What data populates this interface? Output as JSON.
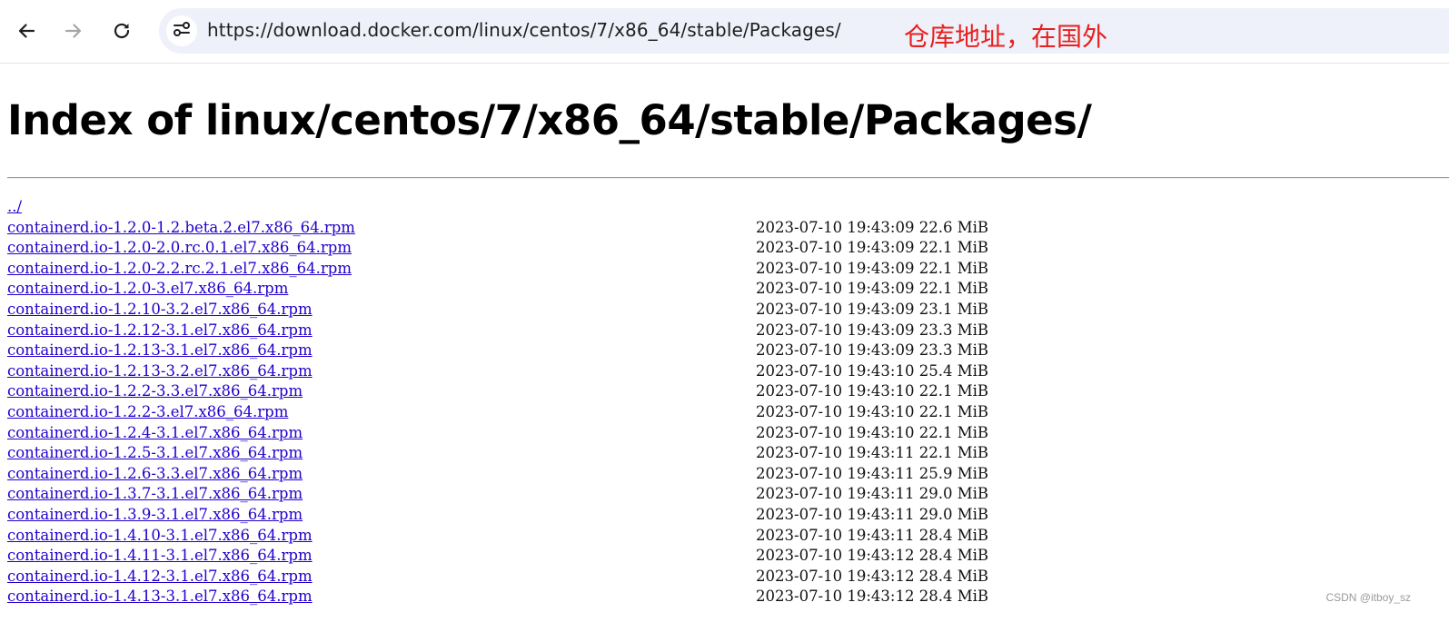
{
  "browser": {
    "back_icon": "arrow-left-icon",
    "forward_icon": "arrow-right-icon",
    "reload_icon": "reload-icon",
    "site_info_icon": "tune-icon",
    "url": "https://download.docker.com/linux/centos/7/x86_64/stable/Packages/"
  },
  "annotation": "仓库地址，在国外",
  "page": {
    "title": "Index of linux/centos/7/x86_64/stable/Packages/",
    "parent_link": "../",
    "files": [
      {
        "name": "containerd.io-1.2.0-1.2.beta.2.el7.x86_64.rpm",
        "date": "2023-07-10 19:43:09",
        "size": "22.6 MiB"
      },
      {
        "name": "containerd.io-1.2.0-2.0.rc.0.1.el7.x86_64.rpm",
        "date": "2023-07-10 19:43:09",
        "size": "22.1 MiB"
      },
      {
        "name": "containerd.io-1.2.0-2.2.rc.2.1.el7.x86_64.rpm",
        "date": "2023-07-10 19:43:09",
        "size": "22.1 MiB"
      },
      {
        "name": "containerd.io-1.2.0-3.el7.x86_64.rpm",
        "date": "2023-07-10 19:43:09",
        "size": "22.1 MiB"
      },
      {
        "name": "containerd.io-1.2.10-3.2.el7.x86_64.rpm",
        "date": "2023-07-10 19:43:09",
        "size": "23.1 MiB"
      },
      {
        "name": "containerd.io-1.2.12-3.1.el7.x86_64.rpm",
        "date": "2023-07-10 19:43:09",
        "size": "23.3 MiB"
      },
      {
        "name": "containerd.io-1.2.13-3.1.el7.x86_64.rpm",
        "date": "2023-07-10 19:43:09",
        "size": "23.3 MiB"
      },
      {
        "name": "containerd.io-1.2.13-3.2.el7.x86_64.rpm",
        "date": "2023-07-10 19:43:10",
        "size": "25.4 MiB"
      },
      {
        "name": "containerd.io-1.2.2-3.3.el7.x86_64.rpm",
        "date": "2023-07-10 19:43:10",
        "size": "22.1 MiB"
      },
      {
        "name": "containerd.io-1.2.2-3.el7.x86_64.rpm",
        "date": "2023-07-10 19:43:10",
        "size": "22.1 MiB"
      },
      {
        "name": "containerd.io-1.2.4-3.1.el7.x86_64.rpm",
        "date": "2023-07-10 19:43:10",
        "size": "22.1 MiB"
      },
      {
        "name": "containerd.io-1.2.5-3.1.el7.x86_64.rpm",
        "date": "2023-07-10 19:43:11",
        "size": "22.1 MiB"
      },
      {
        "name": "containerd.io-1.2.6-3.3.el7.x86_64.rpm",
        "date": "2023-07-10 19:43:11",
        "size": "25.9 MiB"
      },
      {
        "name": "containerd.io-1.3.7-3.1.el7.x86_64.rpm",
        "date": "2023-07-10 19:43:11",
        "size": "29.0 MiB"
      },
      {
        "name": "containerd.io-1.3.9-3.1.el7.x86_64.rpm",
        "date": "2023-07-10 19:43:11",
        "size": "29.0 MiB"
      },
      {
        "name": "containerd.io-1.4.10-3.1.el7.x86_64.rpm",
        "date": "2023-07-10 19:43:11",
        "size": "28.4 MiB"
      },
      {
        "name": "containerd.io-1.4.11-3.1.el7.x86_64.rpm",
        "date": "2023-07-10 19:43:12",
        "size": "28.4 MiB"
      },
      {
        "name": "containerd.io-1.4.12-3.1.el7.x86_64.rpm",
        "date": "2023-07-10 19:43:12",
        "size": "28.4 MiB"
      },
      {
        "name": "containerd.io-1.4.13-3.1.el7.x86_64.rpm",
        "date": "2023-07-10 19:43:12",
        "size": "28.4 MiB"
      }
    ]
  },
  "watermark": "CSDN @itboy_sz"
}
